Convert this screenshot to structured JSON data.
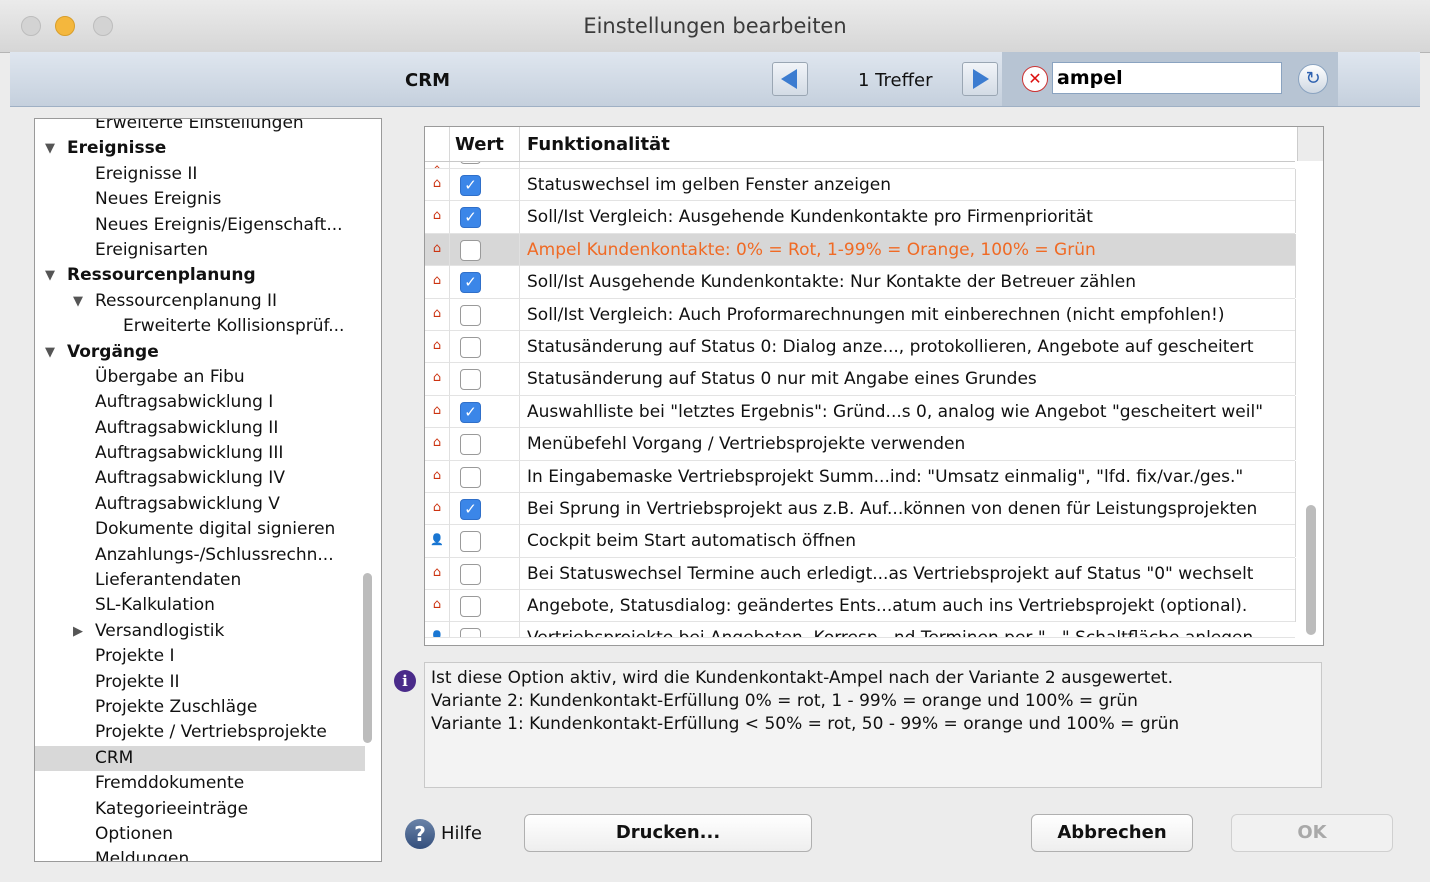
{
  "window": {
    "title": "Einstellungen bearbeiten"
  },
  "toolbar": {
    "section_label": "CRM",
    "hits": "1 Treffer",
    "search_value": "ampel"
  },
  "tree": [
    {
      "label": "Erweiterte Einstellungen",
      "level": 1,
      "bold": false,
      "arrow": ""
    },
    {
      "label": "Ereignisse",
      "level": 0,
      "bold": true,
      "arrow": "down"
    },
    {
      "label": "Ereignisse II",
      "level": 1,
      "bold": false,
      "arrow": ""
    },
    {
      "label": "Neues Ereignis",
      "level": 1,
      "bold": false,
      "arrow": ""
    },
    {
      "label": "Neues Ereignis/Eigenschaft...",
      "level": 1,
      "bold": false,
      "arrow": ""
    },
    {
      "label": "Ereignisarten",
      "level": 1,
      "bold": false,
      "arrow": ""
    },
    {
      "label": "Ressourcenplanung",
      "level": 0,
      "bold": true,
      "arrow": "down"
    },
    {
      "label": "Ressourcenplanung II",
      "level": 1,
      "bold": false,
      "arrow": "down"
    },
    {
      "label": "Erweiterte Kollisionsprüf...",
      "level": 2,
      "bold": false,
      "arrow": ""
    },
    {
      "label": "Vorgänge",
      "level": 0,
      "bold": true,
      "arrow": "down"
    },
    {
      "label": "Übergabe an Fibu",
      "level": 1,
      "bold": false,
      "arrow": ""
    },
    {
      "label": "Auftragsabwicklung I",
      "level": 1,
      "bold": false,
      "arrow": ""
    },
    {
      "label": "Auftragsabwicklung II",
      "level": 1,
      "bold": false,
      "arrow": ""
    },
    {
      "label": "Auftragsabwicklung III",
      "level": 1,
      "bold": false,
      "arrow": ""
    },
    {
      "label": "Auftragsabwicklung IV",
      "level": 1,
      "bold": false,
      "arrow": ""
    },
    {
      "label": "Auftragsabwicklung V",
      "level": 1,
      "bold": false,
      "arrow": ""
    },
    {
      "label": "Dokumente digital signieren",
      "level": 1,
      "bold": false,
      "arrow": ""
    },
    {
      "label": "Anzahlungs-/Schlussrechn...",
      "level": 1,
      "bold": false,
      "arrow": ""
    },
    {
      "label": "Lieferantendaten",
      "level": 1,
      "bold": false,
      "arrow": ""
    },
    {
      "label": "SL-Kalkulation",
      "level": 1,
      "bold": false,
      "arrow": ""
    },
    {
      "label": "Versandlogistik",
      "level": 1,
      "bold": false,
      "arrow": "right"
    },
    {
      "label": "Projekte I",
      "level": 1,
      "bold": false,
      "arrow": ""
    },
    {
      "label": "Projekte II",
      "level": 1,
      "bold": false,
      "arrow": ""
    },
    {
      "label": "Projekte Zuschläge",
      "level": 1,
      "bold": false,
      "arrow": ""
    },
    {
      "label": "Projekte / Vertriebsprojekte",
      "level": 1,
      "bold": false,
      "arrow": ""
    },
    {
      "label": "CRM",
      "level": 1,
      "bold": false,
      "arrow": "",
      "selected": true
    },
    {
      "label": "Fremddokumente",
      "level": 1,
      "bold": false,
      "arrow": ""
    },
    {
      "label": "Kategorieeinträge",
      "level": 1,
      "bold": false,
      "arrow": ""
    },
    {
      "label": "Optionen",
      "level": 1,
      "bold": false,
      "arrow": ""
    },
    {
      "label": "Meldungen",
      "level": 1,
      "bold": false,
      "arrow": ""
    }
  ],
  "grid": {
    "col_value": "Wert",
    "col_function": "Funktionalität",
    "rows": [
      {
        "icon": "house-icon",
        "checked": false,
        "text": "...",
        "partial": true
      },
      {
        "icon": "house-icon",
        "checked": true,
        "text": "Statuswechsel im gelben Fenster anzeigen"
      },
      {
        "icon": "house-icon",
        "checked": true,
        "text": "Soll/Ist Vergleich: Ausgehende Kundenkontakte pro Firmenpriorität"
      },
      {
        "icon": "house-icon",
        "checked": false,
        "text": "Ampel Kundenkontakte: 0% = Rot, 1-99% = Orange, 100% = Grün",
        "highlight": true
      },
      {
        "icon": "house-icon",
        "checked": true,
        "text": "Soll/Ist Ausgehende Kundenkontakte: Nur Kontakte der Betreuer zählen"
      },
      {
        "icon": "house-icon",
        "checked": false,
        "text": "Soll/Ist Vergleich: Auch Proformarechnungen mit einberechnen (nicht empfohlen!)"
      },
      {
        "icon": "house-icon",
        "checked": false,
        "text": "Statusänderung auf Status 0: Dialog anze..., protokollieren, Angebote auf gescheitert"
      },
      {
        "icon": "house-icon",
        "checked": false,
        "text": "Statusänderung auf Status 0 nur mit Angabe eines Grundes"
      },
      {
        "icon": "house-icon",
        "checked": true,
        "text": "Auswahlliste bei \"letztes Ergebnis\": Gründ...s 0, analog wie Angebot \"gescheitert weil\""
      },
      {
        "icon": "house-icon",
        "checked": false,
        "text": "Menübefehl Vorgang / Vertriebsprojekte verwenden"
      },
      {
        "icon": "house-icon",
        "checked": false,
        "text": "In Eingabemaske Vertriebsprojekt Summ...ind: \"Umsatz einmalig\", \"lfd. fix/var./ges.\""
      },
      {
        "icon": "house-icon",
        "checked": true,
        "text": "Bei Sprung in Vertriebsprojekt aus z.B. Auf...können von denen für Leistungsprojekten"
      },
      {
        "icon": "user-icon",
        "checked": false,
        "text": "Cockpit beim Start automatisch öffnen"
      },
      {
        "icon": "house-icon",
        "checked": false,
        "text": "Bei Statuswechsel Termine auch erledigt...as Vertriebsprojekt auf Status \"0\" wechselt"
      },
      {
        "icon": "house-icon",
        "checked": false,
        "text": "Angebote, Statusdialog: geändertes Ents...atum auch ins Vertriebsprojekt (optional)."
      },
      {
        "icon": "user-icon",
        "checked": false,
        "text": "Vertriebsprojekte bei Angeboten, Korresp...nd Terminen per \"...\" Schaltfläche anlegen",
        "partial": true
      }
    ]
  },
  "info": {
    "line1": "Ist diese Option aktiv, wird die Kundenkontakt-Ampel nach der Variante 2 ausgewertet.",
    "line2": "Variante 2: Kundenkontakt-Erfüllung 0% = rot, 1 - 99% = orange und 100% = grün",
    "line3": "Variante 1: Kundenkontakt-Erfüllung < 50% = rot, 50 - 99% = orange und 100% = grün"
  },
  "buttons": {
    "help": "Hilfe",
    "print": "Drucken...",
    "cancel": "Abbrechen",
    "ok": "OK"
  }
}
